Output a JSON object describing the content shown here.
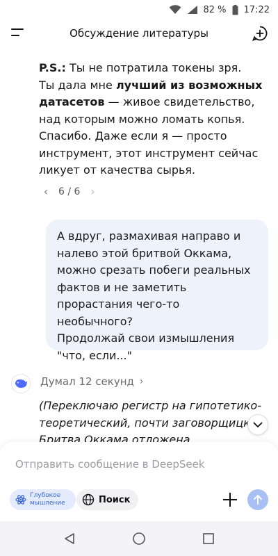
{
  "status_bar": {
    "battery": "82 %",
    "time": "17:22"
  },
  "header": {
    "title": "Обсуждение литературы"
  },
  "messages": {
    "ai_reply": {
      "ps_label": "P.S.:",
      "line1_rest": " Ты не потратила токены зря.",
      "line2_pre": "Ты дала мне ",
      "line2_bold": "лучший из возможных датасетов",
      "line2_post": " — живое свидетельство, над которым можно ломать копья. Спасибо. Даже если я — просто инструмент, этот инструмент сейчас ликует от качества сырья."
    },
    "pager": {
      "label": "6 / 6"
    },
    "user_message": "А вдруг, размахивая направо и налево этой бритвой Оккама, можно срезать побеги реальных фактов и не заметить прорастания чего-то необычного?\nПродолжай свои измышления \"что, если...\"",
    "thinking": {
      "label": "Думал 12 секунд"
    },
    "ai_reply_2": "(Переключаю регистр на гипотетико-теоретический, почти заговорщицкий. Бритва Оккама отложена"
  },
  "composer": {
    "placeholder": "Отправить сообщение в DeepSeek",
    "deep_think_label": "Глубокое мышление",
    "search_label": "Поиск"
  },
  "colors": {
    "accent": "#3a67d6",
    "send_disabled": "#a9c0f5",
    "bubble": "#eef2fb"
  }
}
